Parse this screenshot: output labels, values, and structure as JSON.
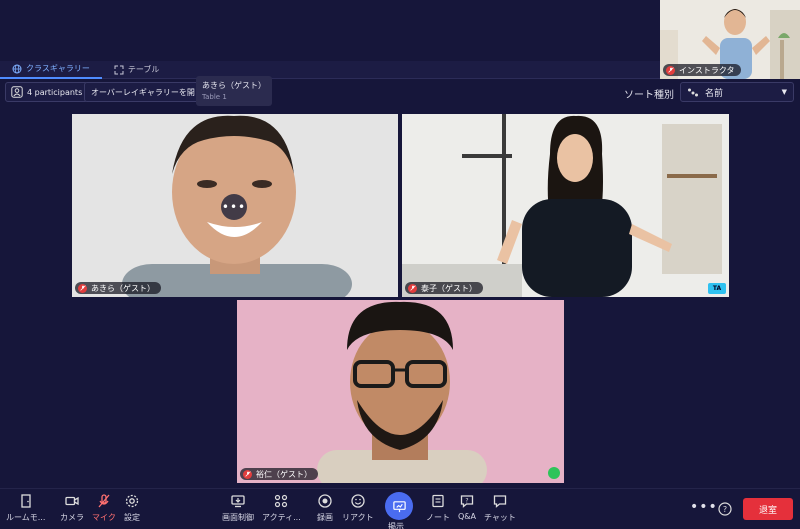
{
  "tabs": [
    {
      "label": "クラスギャラリー",
      "active": true
    },
    {
      "label": "テーブル",
      "active": false
    }
  ],
  "controls": {
    "participants_label": "4 participants",
    "overlay_label": "オーバーレイギャラリーを開く",
    "sort_label": "ソート種別",
    "sort_value": "名前"
  },
  "tooltip": {
    "name": "あきら（ゲスト）",
    "table": "Table 1"
  },
  "instructor": {
    "name": "インストラクタ"
  },
  "tiles": [
    {
      "name": "あきら（ゲスト）"
    },
    {
      "name": "泰子（ゲスト）",
      "badge": "TA"
    },
    {
      "name": "裕仁（ゲスト）"
    }
  ],
  "toolbar": {
    "room_mode": "ルームモ...",
    "camera": "カメラ",
    "mic": "マイク",
    "settings": "設定",
    "screen_control": "画面制御",
    "activity": "アクティ...",
    "record": "録画",
    "react": "リアクト",
    "present": "掲示",
    "notes": "ノート",
    "qa": "Q&A",
    "chat": "チャット",
    "leave": "退室"
  },
  "colors": {
    "accent": "#4a6cf0",
    "leave": "#e5303b",
    "ta_badge": "#2fc1f0"
  }
}
